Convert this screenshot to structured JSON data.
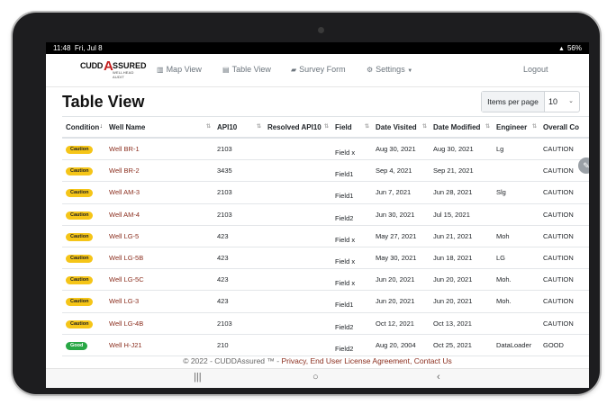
{
  "status": {
    "time": "11:48",
    "date": "Fri, Jul 8",
    "battery": "56%"
  },
  "nav": {
    "logo_cudd": "CUDD",
    "logo_assured": "SSURED",
    "logo_tag": "WELLHEAD AUDIT",
    "map": "Map View",
    "table": "Table View",
    "survey": "Survey Form",
    "settings": "Settings",
    "logout": "Logout"
  },
  "page": {
    "title": "Table View",
    "items_per_page_label": "Items per page",
    "items_per_page_value": "10"
  },
  "columns": [
    "Condition",
    "Well Name",
    "API10",
    "Resolved API10",
    "Field",
    "Date Visited",
    "Date Modified",
    "Engineer",
    "Overall Co"
  ],
  "rows": [
    {
      "condition": "Caution",
      "well": "Well BR-1",
      "api10": "2103",
      "resolved": "",
      "field": "Field x",
      "visited": "Aug 30, 2021",
      "modified": "Aug 30, 2021",
      "engineer": "Lg",
      "overall": "CAUTION"
    },
    {
      "condition": "Caution",
      "well": "Well BR-2",
      "api10": "3435",
      "resolved": "",
      "field": "Field1",
      "visited": "Sep 4, 2021",
      "modified": "Sep 21, 2021",
      "engineer": "",
      "overall": "CAUTION"
    },
    {
      "condition": "Caution",
      "well": "Well AM-3",
      "api10": "2103",
      "resolved": "",
      "field": "Field1",
      "visited": "Jun 7, 2021",
      "modified": "Jun 28, 2021",
      "engineer": "Slg",
      "overall": "CAUTION"
    },
    {
      "condition": "Caution",
      "well": "Well AM-4",
      "api10": "2103",
      "resolved": "",
      "field": "Field2",
      "visited": "Jun 30, 2021",
      "modified": "Jul 15, 2021",
      "engineer": "",
      "overall": "CAUTION"
    },
    {
      "condition": "Caution",
      "well": "Well LG-5",
      "api10": "423",
      "resolved": "",
      "field": "Field x",
      "visited": "May 27, 2021",
      "modified": "Jun 21, 2021",
      "engineer": "Moh",
      "overall": "CAUTION"
    },
    {
      "condition": "Caution",
      "well": "Well LG-5B",
      "api10": "423",
      "resolved": "",
      "field": "Field x",
      "visited": "May 30, 2021",
      "modified": "Jun 18, 2021",
      "engineer": "LG",
      "overall": "CAUTION"
    },
    {
      "condition": "Caution",
      "well": "Well LG-5C",
      "api10": "423",
      "resolved": "",
      "field": "Field x",
      "visited": "Jun 20, 2021",
      "modified": "Jun 20, 2021",
      "engineer": "Moh.",
      "overall": "CAUTION"
    },
    {
      "condition": "Caution",
      "well": "Well LG-3",
      "api10": "423",
      "resolved": "",
      "field": "Field1",
      "visited": "Jun 20, 2021",
      "modified": "Jun 20, 2021",
      "engineer": "Moh.",
      "overall": "CAUTION"
    },
    {
      "condition": "Caution",
      "well": "Well LG-4B",
      "api10": "2103",
      "resolved": "",
      "field": "Field2",
      "visited": "Oct 12, 2021",
      "modified": "Oct 13, 2021",
      "engineer": "",
      "overall": "CAUTION"
    },
    {
      "condition": "Good",
      "well": "Well H-J21",
      "api10": "210",
      "resolved": "",
      "field": "Field2",
      "visited": "Aug 20, 2004",
      "modified": "Oct 25, 2021",
      "engineer": "DataLoader",
      "overall": "GOOD"
    }
  ],
  "badge_colors": {
    "Caution": "#f5c518",
    "Good": "#28a745"
  },
  "footer": {
    "prefix": "© 2022 - CUDDAssured ™ - ",
    "privacy": "Privacy",
    "sep1": ", ",
    "eula": "End User License Agreement",
    "sep2": ", ",
    "contact": "Contact Us"
  },
  "icons": {
    "map": "map-icon",
    "table": "table-icon",
    "survey": "book-icon",
    "settings": "gear-icon",
    "edit": "pencil-icon"
  }
}
